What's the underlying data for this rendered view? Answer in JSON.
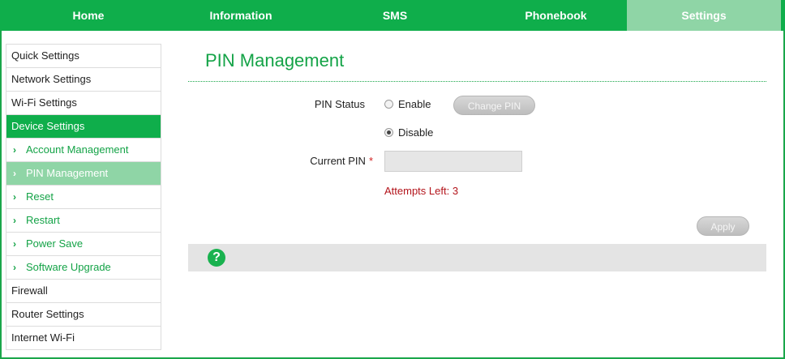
{
  "nav": {
    "tabs": [
      {
        "label": "Home"
      },
      {
        "label": "Information"
      },
      {
        "label": "SMS"
      },
      {
        "label": "Phonebook"
      },
      {
        "label": "Settings"
      }
    ],
    "active": "Settings"
  },
  "sidebar": {
    "items": [
      {
        "label": "Quick Settings"
      },
      {
        "label": "Network Settings"
      },
      {
        "label": "Wi-Fi Settings"
      },
      {
        "label": "Device Settings"
      },
      {
        "label": "Account Management"
      },
      {
        "label": "PIN Management"
      },
      {
        "label": "Reset"
      },
      {
        "label": "Restart"
      },
      {
        "label": "Power Save"
      },
      {
        "label": "Software Upgrade"
      },
      {
        "label": "Firewall"
      },
      {
        "label": "Router Settings"
      },
      {
        "label": "Internet Wi-Fi"
      }
    ],
    "chevron": "›"
  },
  "main": {
    "title": "PIN Management",
    "pin_status_label": "PIN Status",
    "enable_label": "Enable",
    "disable_label": "Disable",
    "selected_status": "Disable",
    "change_pin_label": "Change PIN",
    "current_pin_label": "Current PIN",
    "required_mark": "*",
    "current_pin_value": "",
    "attempts_text": "Attempts Left: 3",
    "apply_label": "Apply",
    "help_glyph": "?"
  },
  "colors": {
    "brand_green": "#0fae4b",
    "active_tab": "#8fd5a6",
    "error_red": "#b3141b"
  }
}
